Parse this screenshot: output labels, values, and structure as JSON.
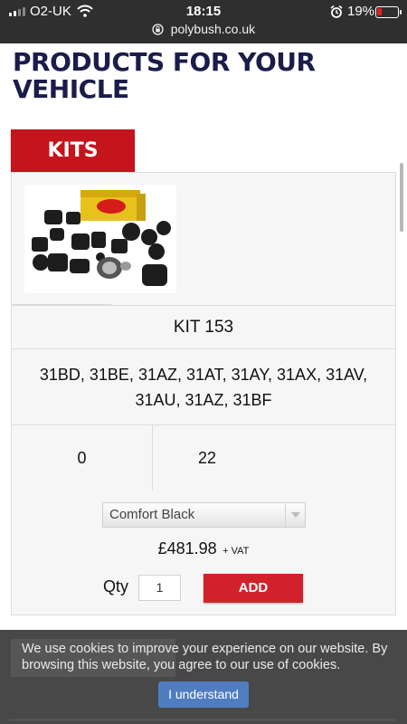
{
  "status_bar": {
    "carrier": "O2-UK",
    "time": "18:15",
    "battery": "19%",
    "battery_color": "#e0201f"
  },
  "browser": {
    "url": "polybush.co.uk"
  },
  "page": {
    "title": "PRODUCTS FOR YOUR VEHICLE",
    "tab_label": "KITS"
  },
  "product": {
    "image_icon": "polyurethane-bush-kit-photo",
    "name": "KIT 153",
    "codes": "31BD, 31BE, 31AZ, 31AT, 31AY, 31AX, 31AV, 31AU, 31AZ, 31BF",
    "col1": "0",
    "col2": "22",
    "option_selected": "Comfort Black",
    "price": "£481.98",
    "vat_label": "+ VAT",
    "qty_label": "Qty",
    "qty_value": "1",
    "add_label": "ADD"
  },
  "cookie_banner": {
    "text": "We use cookies to improve your experience on our website. By browsing this website, you agree to our use of cookies.",
    "button_label": "I understand"
  },
  "colors": {
    "brand_red": "#c4141c",
    "title_navy": "#1a1d4a",
    "cookie_button": "#4f7dc0"
  }
}
